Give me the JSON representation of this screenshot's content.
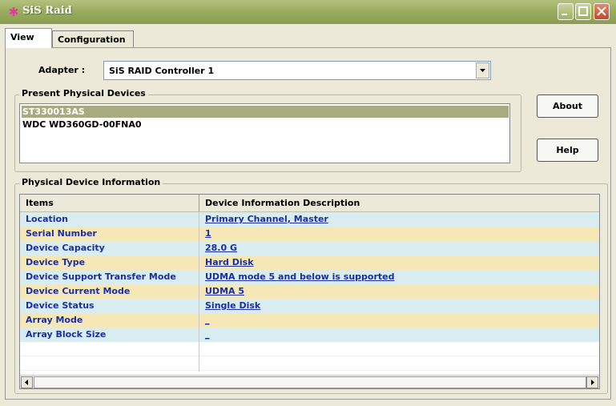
{
  "window": {
    "title": "SiS Raid"
  },
  "tabs": [
    {
      "label": "View"
    },
    {
      "label": "Configuration"
    }
  ],
  "adapter": {
    "label": "Adapter :",
    "value": "SiS RAID Controller 1"
  },
  "devices": {
    "group_title": "Present Physical Devices",
    "items": [
      {
        "label": "ST330013AS"
      },
      {
        "label": "WDC WD360GD-00FNA0"
      }
    ]
  },
  "buttons": {
    "about": "About",
    "help": "Help"
  },
  "info": {
    "group_title": "Physical Device Information",
    "headers": {
      "items": "Items",
      "desc": "Device Information Description"
    },
    "rows": [
      {
        "item": "Location",
        "value": "Primary Channel, Master"
      },
      {
        "item": "Serial Number",
        "value": "1"
      },
      {
        "item": "Device Capacity",
        "value": "28.0 G"
      },
      {
        "item": "Device Type",
        "value": "Hard Disk"
      },
      {
        "item": "Device Support Transfer Mode",
        "value": "UDMA mode 5 and below is supported"
      },
      {
        "item": "Device Current Mode",
        "value": "UDMA 5"
      },
      {
        "item": "Device Status",
        "value": "Single Disk"
      },
      {
        "item": "Array Mode",
        "value": "_"
      },
      {
        "item": "Array Block Size",
        "value": "_"
      }
    ]
  },
  "colors": {
    "row_even": "#d9ecef",
    "row_odd": "#f6e8b6",
    "selection": "#a8ab80",
    "link_text": "#1b2ea3"
  }
}
